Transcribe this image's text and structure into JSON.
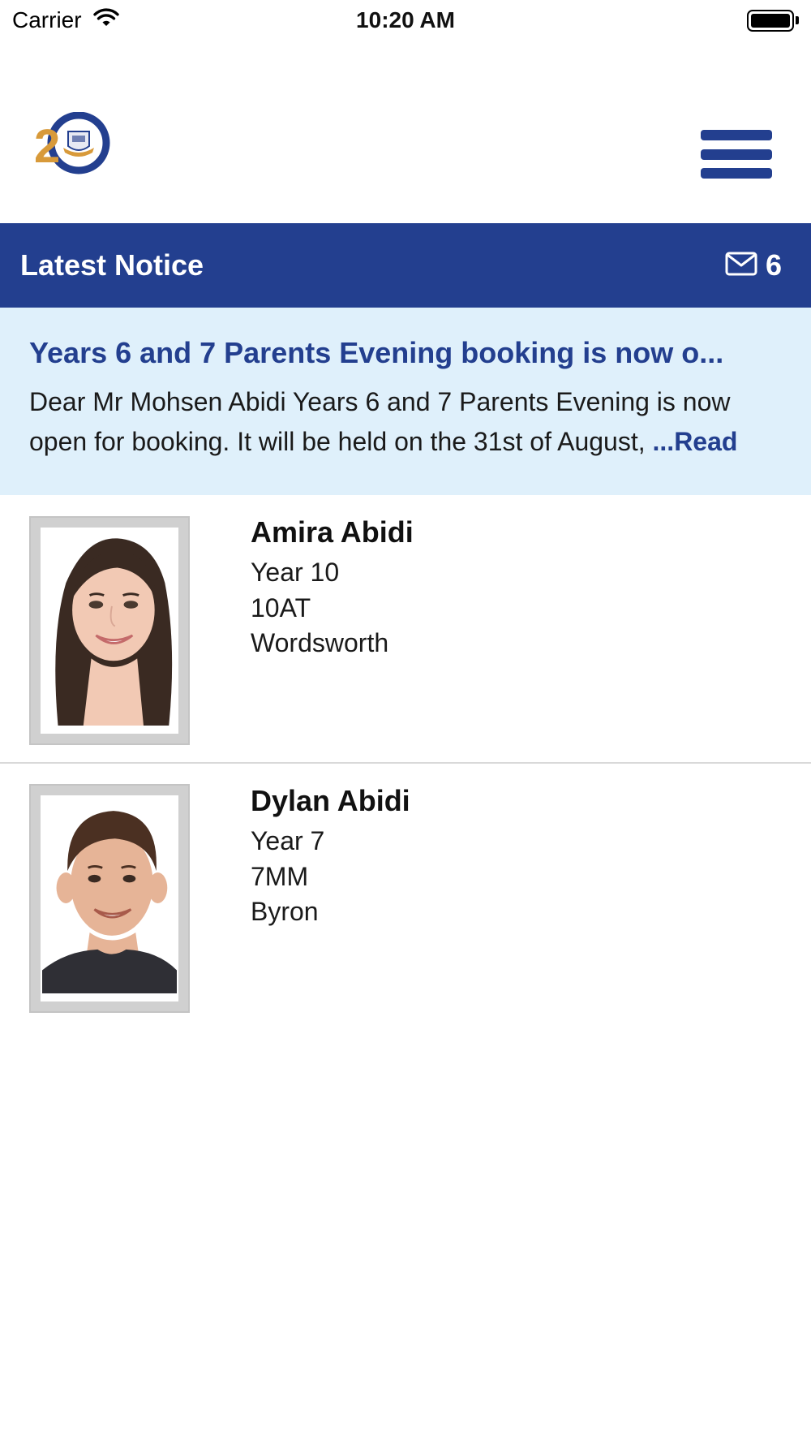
{
  "status_bar": {
    "carrier": "Carrier",
    "time": "10:20 AM"
  },
  "header": {
    "logo_text": "2"
  },
  "notice_bar": {
    "title": "Latest Notice",
    "count": "6",
    "icon": "envelope-icon"
  },
  "notice": {
    "headline": "Years 6 and 7 Parents Evening booking is now o...",
    "body": "Dear Mr Mohsen Abidi Years 6 and 7 Parents Evening is now open for booking. It will be held on the 31st of August,",
    "read_more": "...Read"
  },
  "students": [
    {
      "name": "Amira Abidi",
      "year": "Year 10",
      "form": "10AT",
      "house": "Wordsworth"
    },
    {
      "name": "Dylan Abidi",
      "year": "Year 7",
      "form": "7MM",
      "house": "Byron"
    }
  ],
  "colors": {
    "brand_blue": "#233f8f",
    "notice_bg": "#dff0fb",
    "logo_gold": "#d89a3a"
  }
}
